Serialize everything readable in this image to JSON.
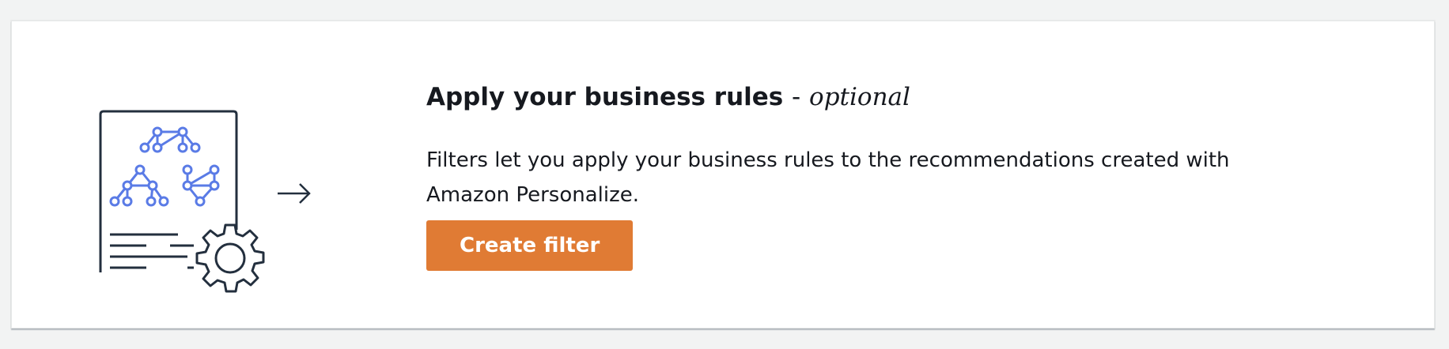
{
  "section": {
    "title": "Apply your business rules",
    "title_separator": "-",
    "title_optional": "optional",
    "description": "Filters let you apply your business rules to the recommendations created with Amazon Personalize.",
    "create_button_label": "Create filter"
  },
  "icons": {
    "illustration": "document-network-gear-icon",
    "arrow": "arrow-right-icon"
  },
  "colors": {
    "background": "#f2f3f3",
    "card": "#ffffff",
    "text": "#16191f",
    "button": "#e07b34",
    "button_text": "#ffffff",
    "illustration_lines": "#232f3e",
    "illustration_network": "#5a7be6"
  }
}
